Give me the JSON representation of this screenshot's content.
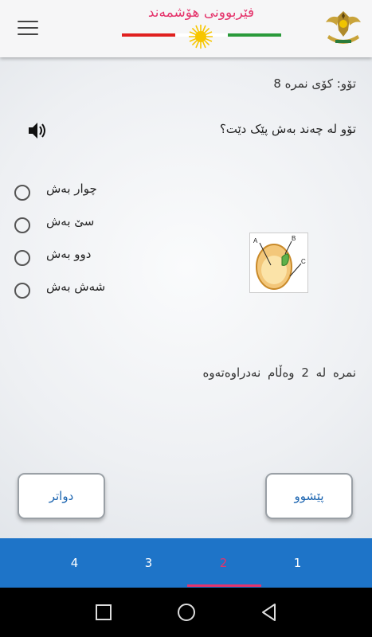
{
  "header": {
    "app_title": "فێربوونی هۆشمەند",
    "menu_icon": "hamburger-menu-icon",
    "logo_icon": "kurdistan-emblem-icon",
    "flag_colors": {
      "red": "#e0201f",
      "white": "#ffffff",
      "green": "#2a9a3a",
      "sun": "#f7c600"
    }
  },
  "lesson": {
    "title": "تۆو: کۆی نمرە 8"
  },
  "question": {
    "speaker_icon": "speaker-icon",
    "text": "تۆو لە چەند بەش پێک دێت؟",
    "image_icon": "seed-diagram-image",
    "diagram_labels": [
      "A",
      "B",
      "C"
    ],
    "options": [
      {
        "label": "چوار بەش"
      },
      {
        "label": "سێ بەش"
      },
      {
        "label": "دوو بەش"
      },
      {
        "label": "شەش بەش"
      }
    ]
  },
  "status": {
    "score_text": "نمرە لە 2    وەڵام نەدراوەتەوە"
  },
  "buttons": {
    "next_label": "دواتر",
    "previous_label": "پێشوو"
  },
  "tabs": {
    "items": [
      {
        "label": "4"
      },
      {
        "label": "3"
      },
      {
        "label": "2",
        "active": true
      },
      {
        "label": "1"
      }
    ],
    "bar_color": "#1e74c8",
    "active_color": "#e5336b"
  },
  "system_nav": {
    "icons": [
      "recent-apps-icon",
      "home-icon",
      "back-icon"
    ]
  }
}
